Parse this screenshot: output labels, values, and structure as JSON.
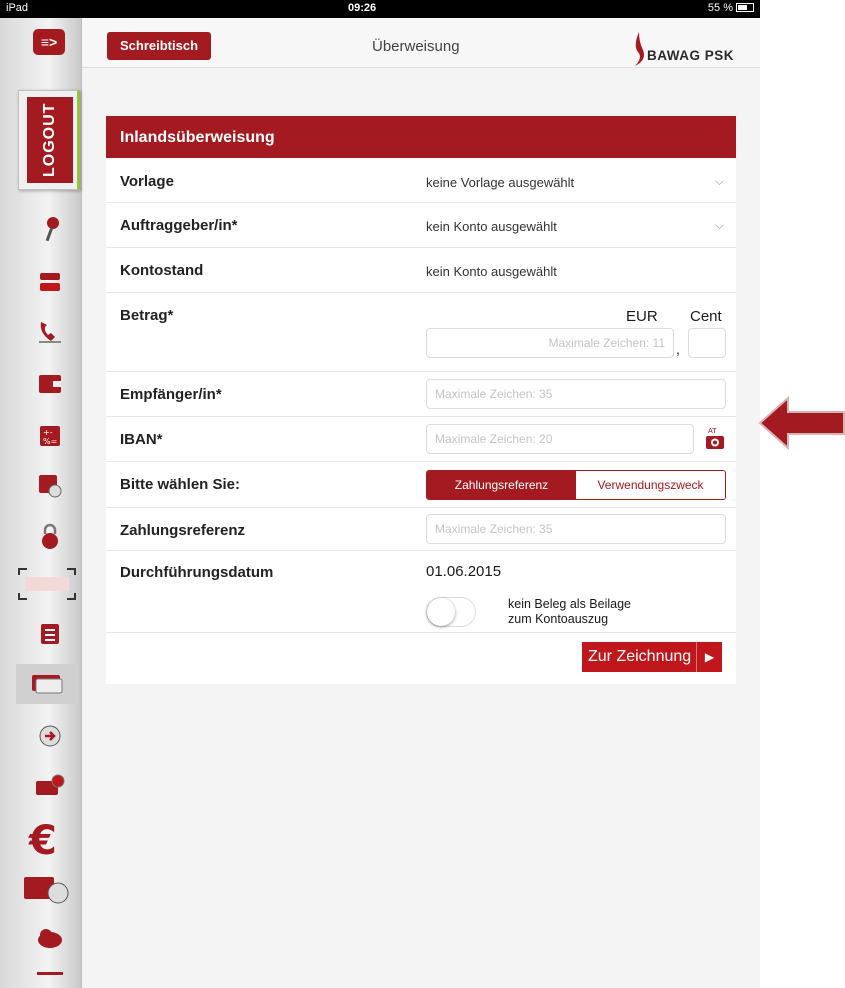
{
  "status_bar": {
    "device": "iPad",
    "time": "09:26",
    "battery": "55 %"
  },
  "sidebar": {
    "menu_label": "≡>",
    "logout_label": "LOGOUT",
    "icons": [
      "pin-icon",
      "document-icon",
      "phone-icon",
      "wallet-icon",
      "calculator-icon",
      "calculator-euro-icon",
      "lock-icon",
      "scan-icon",
      "list-icon",
      "cards-icon",
      "globe-clock-icon",
      "card-globe-icon",
      "euro-icon",
      "card-clock-icon",
      "cloud-icon",
      "more-icon"
    ]
  },
  "topbar": {
    "desk_button": "Schreibtisch",
    "title": "Überweisung",
    "logo_text": "BAWAG PSK"
  },
  "form": {
    "header": "Inlandsüberweisung",
    "vorlage": {
      "label": "Vorlage",
      "value": "keine Vorlage ausgewählt"
    },
    "auftraggeber": {
      "label": "Auftraggeber/in*",
      "value": "kein Konto ausgewählt"
    },
    "kontostand": {
      "label": "Kontostand",
      "value": "kein Konto ausgewählt"
    },
    "betrag": {
      "label": "Betrag*",
      "eur_label": "EUR",
      "cent_label": "Cent",
      "eur_placeholder": "Maximale Zeichen: 11",
      "separator": ","
    },
    "empfaenger": {
      "label": "Empfänger/in*",
      "placeholder": "Maximale Zeichen: 35"
    },
    "iban": {
      "label": "IBAN*",
      "placeholder": "Maximale Zeichen: 20",
      "camera_badge": "AT"
    },
    "auswahl": {
      "label": "Bitte wählen Sie:",
      "option_active": "Zahlungsreferenz",
      "option_inactive": "Verwendungszweck"
    },
    "zahlungsreferenz": {
      "label": "Zahlungsreferenz",
      "placeholder": "Maximale Zeichen: 35"
    },
    "datum": {
      "label": "Durchführungsdatum",
      "value": "01.06.2015",
      "toggle_text_1": "kein Beleg als Beilage",
      "toggle_text_2": "zum Kontoauszug",
      "toggle_on": false
    },
    "submit_label": "Zur Zeichnung"
  },
  "colors": {
    "accent": "#a31b20",
    "arrow": "#a31b20"
  }
}
